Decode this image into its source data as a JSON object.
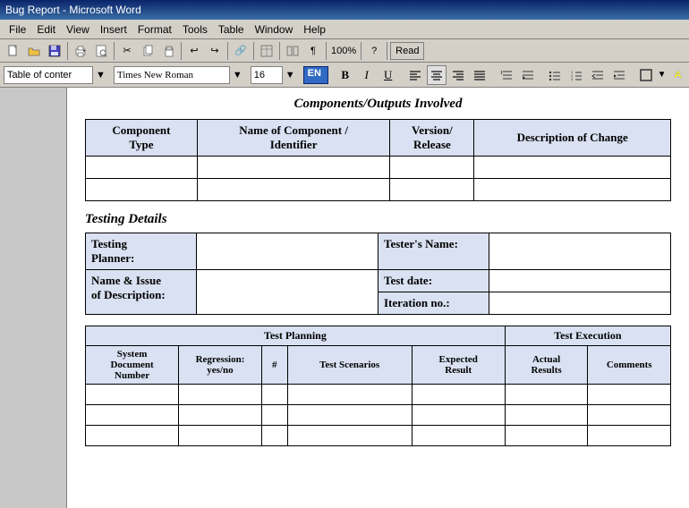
{
  "titleBar": {
    "title": "Bug Report - Microsoft Word"
  },
  "menuBar": {
    "items": [
      "File",
      "Edit",
      "View",
      "Insert",
      "Format",
      "Tools",
      "Table",
      "Window",
      "Help"
    ]
  },
  "toolbar1": {
    "fontName": "Times New Roman",
    "fontSize": "16",
    "langCode": "EN",
    "zoomLevel": "100%",
    "readLabel": "Read"
  },
  "toolbar2": {
    "styleBox": "Table of conter"
  },
  "document": {
    "componentsSection": {
      "title": "Components/Outputs Involved",
      "tableHeaders": [
        "Component Type",
        "Name of Component / Identifier",
        "Version/ Release",
        "Description of Change"
      ],
      "emptyRows": 2
    },
    "testingSection": {
      "title": "Testing Details",
      "rows": [
        {
          "label": "Testing Planner:",
          "testerLabel": "Tester's Name:"
        },
        {
          "label": "Name & Issue of Description:",
          "testDateLabel": "Test date:",
          "iterationLabel": "Iteration no.:"
        }
      ]
    },
    "planningSection": {
      "testPlanningLabel": "Test Planning",
      "testExecutionLabel": "Test Execution",
      "subHeaders": [
        "System Document Number",
        "Regression: yes/no",
        "#",
        "Test Scenarios",
        "Expected Result",
        "Actual Results",
        "Comments"
      ],
      "emptyRows": 3
    }
  }
}
